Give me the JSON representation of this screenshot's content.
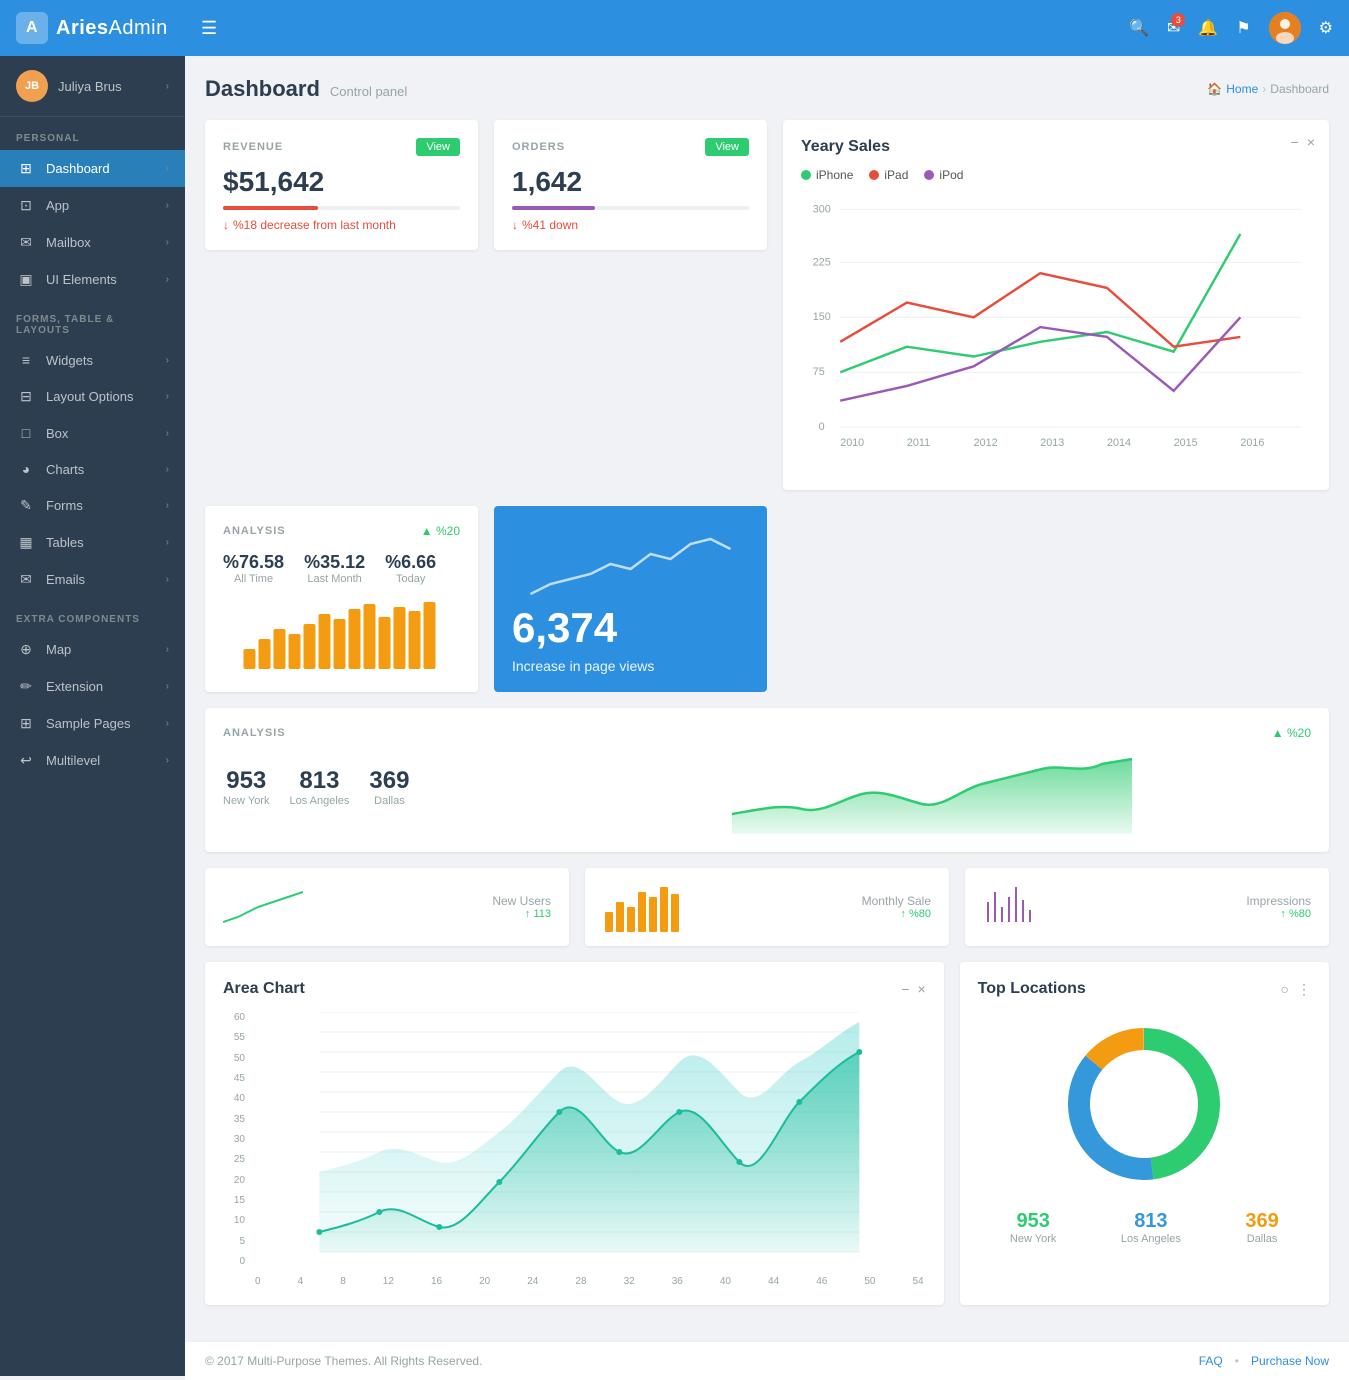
{
  "brand": {
    "icon": "A",
    "name_bold": "Aries",
    "name_light": "Admin"
  },
  "topnav": {
    "hamburger": "☰",
    "icons": {
      "search": "🔍",
      "mail": "✉",
      "bell": "🔔",
      "flag": "⚑",
      "settings": "⚙"
    },
    "badge_count": "3"
  },
  "sidebar": {
    "user_name": "Juliya Brus",
    "user_initials": "JB",
    "sections": [
      {
        "title": "PERSONAL",
        "items": [
          {
            "label": "Dashboard",
            "icon": "⊞",
            "active": true
          },
          {
            "label": "App",
            "icon": "⊡",
            "active": false
          },
          {
            "label": "Mailbox",
            "icon": "✉",
            "active": false
          },
          {
            "label": "UI Elements",
            "icon": "▣",
            "active": false
          }
        ]
      },
      {
        "title": "FORMS, TABLE & LAYOUTS",
        "items": [
          {
            "label": "Widgets",
            "icon": "≡",
            "active": false
          },
          {
            "label": "Layout Options",
            "icon": "⊟",
            "active": false
          },
          {
            "label": "Box",
            "icon": "□",
            "active": false
          },
          {
            "label": "Charts",
            "icon": "◕",
            "active": false
          },
          {
            "label": "Forms",
            "icon": "✎",
            "active": false
          },
          {
            "label": "Tables",
            "icon": "▦",
            "active": false
          },
          {
            "label": "Emails",
            "icon": "✉",
            "active": false
          }
        ]
      },
      {
        "title": "EXTRA COMPONENTS",
        "items": [
          {
            "label": "Map",
            "icon": "⊕",
            "active": false
          },
          {
            "label": "Extension",
            "icon": "✏",
            "active": false
          },
          {
            "label": "Sample Pages",
            "icon": "⊞",
            "active": false
          },
          {
            "label": "Multilevel",
            "icon": "↩",
            "active": false
          }
        ]
      }
    ]
  },
  "page": {
    "title": "Dashboard",
    "subtitle": "Control panel",
    "breadcrumb_home": "Home",
    "breadcrumb_current": "Dashboard"
  },
  "revenue_card": {
    "label": "REVENUE",
    "btn_label": "View",
    "value": "$51,642",
    "trend": "%18 decrease from last month",
    "trend_type": "down"
  },
  "orders_card": {
    "label": "ORDERS",
    "btn_label": "View",
    "value": "1,642",
    "trend": "%41 down",
    "trend_type": "down"
  },
  "yearly_sales": {
    "title": "Yeary Sales",
    "legend": [
      {
        "label": "iPhone",
        "color": "#2ecc71"
      },
      {
        "label": "iPad",
        "color": "#e74c3c"
      },
      {
        "label": "iPod",
        "color": "#9b59b6"
      }
    ],
    "y_labels": [
      "300",
      "225",
      "150",
      "75",
      "0"
    ],
    "x_labels": [
      "2010",
      "2011",
      "2012",
      "2013",
      "2014",
      "2015",
      "2016"
    ]
  },
  "analysis_top": {
    "label": "ANALYSIS",
    "trend": "%20",
    "stats": [
      {
        "value": "%76.58",
        "label": "All Time"
      },
      {
        "value": "%35.12",
        "label": "Last Month"
      },
      {
        "value": "%6.66",
        "label": "Today"
      }
    ]
  },
  "page_views": {
    "value": "6,374",
    "label": "Increase in page views"
  },
  "analysis_bottom": {
    "label": "ANALYSIS",
    "trend": "%20",
    "stats": [
      {
        "value": "953",
        "label": "New York"
      },
      {
        "value": "813",
        "label": "Los Angeles"
      },
      {
        "value": "369",
        "label": "Dallas"
      }
    ]
  },
  "small_stats": [
    {
      "label": "New Users",
      "value": "113",
      "trend": "113",
      "trend_icon": "↑"
    },
    {
      "label": "Monthly Sale",
      "value": "%80",
      "trend": "%80",
      "trend_icon": "↑"
    },
    {
      "label": "Impressions",
      "value": "%80",
      "trend": "%80",
      "trend_icon": "↑"
    }
  ],
  "area_chart": {
    "title": "Area Chart",
    "y_labels": [
      "60",
      "55",
      "50",
      "45",
      "40",
      "35",
      "30",
      "25",
      "20",
      "15",
      "10",
      "5",
      "0"
    ],
    "x_labels": [
      "0",
      "4",
      "8",
      "12",
      "16",
      "20",
      "24",
      "28",
      "32",
      "36",
      "40",
      "44",
      "46",
      "50",
      "54"
    ]
  },
  "top_locations": {
    "title": "Top Locations",
    "locations": [
      {
        "value": "953",
        "label": "New York",
        "color": "#2ecc71"
      },
      {
        "value": "813",
        "label": "Los Angeles",
        "color": "#3498db"
      },
      {
        "value": "369",
        "label": "Dallas",
        "color": "#f39c12"
      }
    ],
    "donut": {
      "green_pct": 48,
      "blue_pct": 38,
      "gold_pct": 14
    }
  },
  "footer": {
    "copyright": "© 2017 Multi-Purpose Themes. All Rights Reserved.",
    "links": [
      "FAQ",
      "Purchase Now"
    ]
  }
}
